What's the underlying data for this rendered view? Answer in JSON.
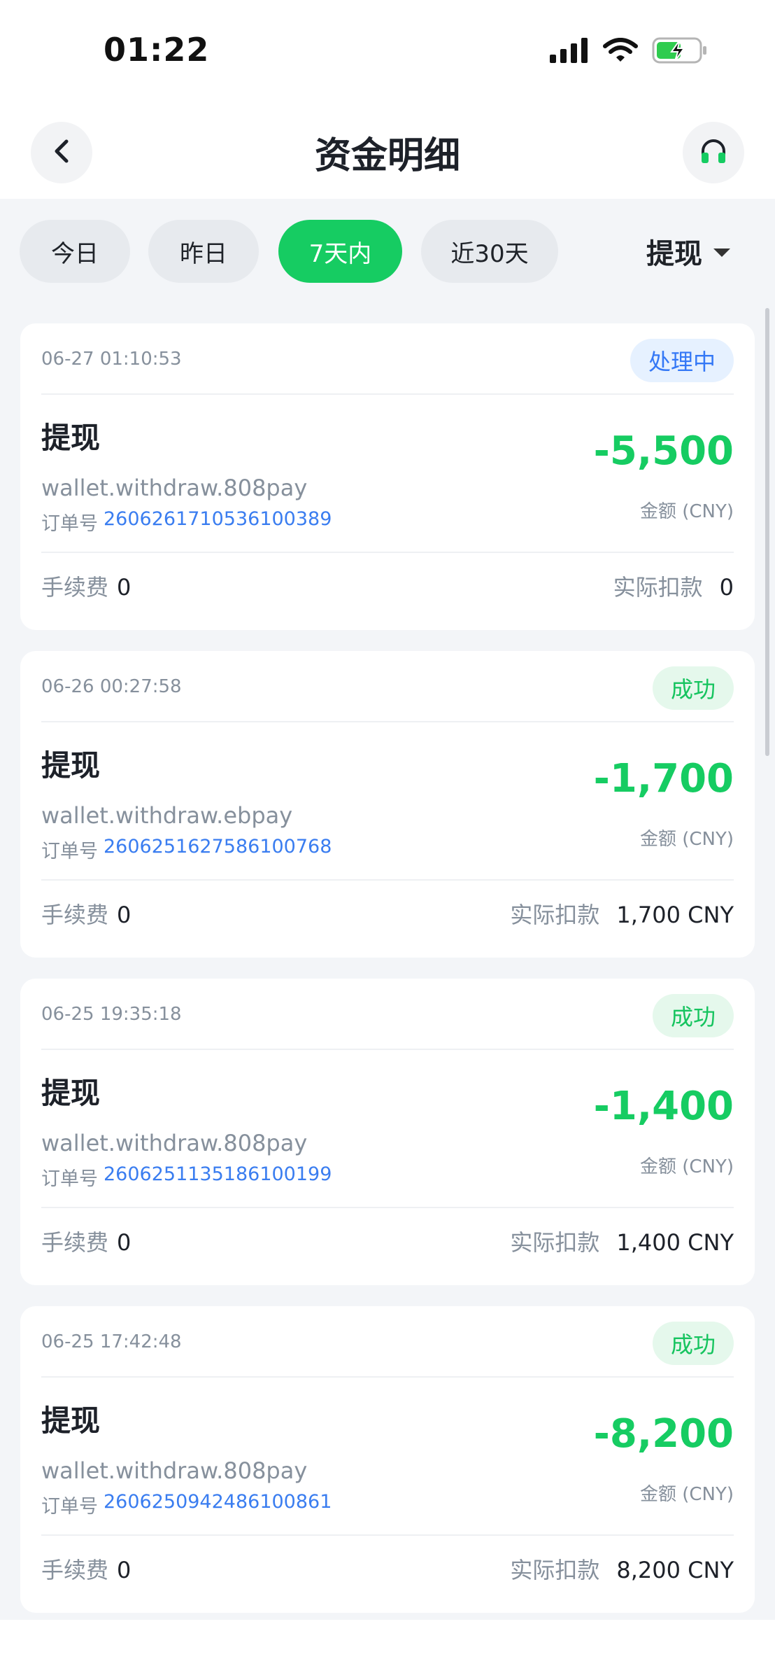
{
  "status_bar": {
    "time": "01:22",
    "icons": [
      "signal-icon",
      "wifi-icon",
      "battery-charging-icon"
    ]
  },
  "header": {
    "title": "资金明细",
    "back_icon": "chevron-left-icon",
    "support_icon": "headset-icon"
  },
  "filters": {
    "tabs": [
      {
        "label": "今日",
        "active": false
      },
      {
        "label": "昨日",
        "active": false
      },
      {
        "label": "7天内",
        "active": true
      },
      {
        "label": "近30天",
        "active": false
      }
    ],
    "type_select": "提现"
  },
  "colors": {
    "accent": "#16cc62",
    "link": "#3a7df0",
    "processing": "#3478f6",
    "background": "#f3f5f8"
  },
  "records": [
    {
      "time": "06-27 01:10:53",
      "status": "处理中",
      "status_type": "processing",
      "type": "提现",
      "channel": "wallet.withdraw.808pay",
      "order_label": "订单号",
      "order_no": "2606261710536100389",
      "amount": "-5,500",
      "amount_caption": "金额 (CNY)",
      "fee_label": "手续费",
      "fee": "0",
      "deduct_label": "实际扣款",
      "deduct": "0"
    },
    {
      "time": "06-26 00:27:58",
      "status": "成功",
      "status_type": "success",
      "type": "提现",
      "channel": "wallet.withdraw.ebpay",
      "order_label": "订单号",
      "order_no": "2606251627586100768",
      "amount": "-1,700",
      "amount_caption": "金额 (CNY)",
      "fee_label": "手续费",
      "fee": "0",
      "deduct_label": "实际扣款",
      "deduct": "1,700 CNY"
    },
    {
      "time": "06-25 19:35:18",
      "status": "成功",
      "status_type": "success",
      "type": "提现",
      "channel": "wallet.withdraw.808pay",
      "order_label": "订单号",
      "order_no": "2606251135186100199",
      "amount": "-1,400",
      "amount_caption": "金额 (CNY)",
      "fee_label": "手续费",
      "fee": "0",
      "deduct_label": "实际扣款",
      "deduct": "1,400 CNY"
    },
    {
      "time": "06-25 17:42:48",
      "status": "成功",
      "status_type": "success",
      "type": "提现",
      "channel": "wallet.withdraw.808pay",
      "order_label": "订单号",
      "order_no": "2606250942486100861",
      "amount": "-8,200",
      "amount_caption": "金额 (CNY)",
      "fee_label": "手续费",
      "fee": "0",
      "deduct_label": "实际扣款",
      "deduct": "8,200 CNY"
    }
  ]
}
